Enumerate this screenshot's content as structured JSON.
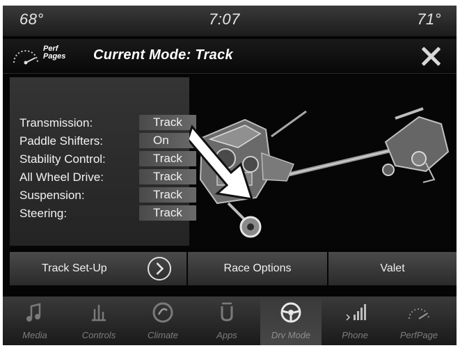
{
  "status": {
    "temp_left": "68°",
    "time": "7:07",
    "temp_right": "71°"
  },
  "header": {
    "perf_line1": "Perf",
    "perf_line2": "Pages",
    "title": "Current Mode: Track"
  },
  "settings": [
    {
      "label": "Transmission:",
      "value": "Track"
    },
    {
      "label": "Paddle Shifters:",
      "value": "On"
    },
    {
      "label": "Stability Control:",
      "value": "Track"
    },
    {
      "label": "All Wheel Drive:",
      "value": "Track"
    },
    {
      "label": "Suspension:",
      "value": "Track"
    },
    {
      "label": "Steering:",
      "value": "Track"
    }
  ],
  "buttons": {
    "track_setup": "Track Set-Up",
    "race_options": "Race Options",
    "valet": "Valet"
  },
  "nav": [
    {
      "label": "Media",
      "icon": "music-note-icon"
    },
    {
      "label": "Controls",
      "icon": "controls-icon"
    },
    {
      "label": "Climate",
      "icon": "climate-icon"
    },
    {
      "label": "Apps",
      "icon": "apps-icon"
    },
    {
      "label": "Drv Mode",
      "icon": "steering-wheel-icon"
    },
    {
      "label": "Phone",
      "icon": "phone-icon"
    },
    {
      "label": "PerfPage",
      "icon": "gauge-icon"
    }
  ],
  "active_nav": "Drv Mode"
}
